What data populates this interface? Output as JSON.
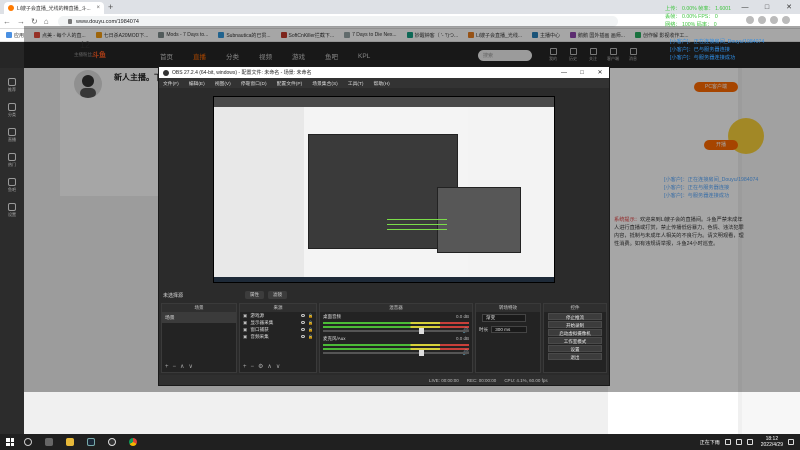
{
  "browser": {
    "tab_title": "Li嫂子会直播_光线的精直播_斗...",
    "url": "www.douyu.com/1984074",
    "bookmarks": [
      "应用",
      "点美 - 每个人的直...",
      "七日杀A20MOD下...",
      "Mods - 7 Days to...",
      "Subnautica的已贯...",
      "SoftCnKiller拦截下...",
      "7 Days to Die Nex...",
      "妙醒钟客（ '- '!)つ...",
      "Li嫂子会直播_光线...",
      "主播中心",
      "鹅鹅 国外插画 画师...",
      "创作解 影视收作工..."
    ]
  },
  "douyu": {
    "logo": "斗鱼",
    "nav": [
      "首页",
      "直播",
      "分类",
      "视频",
      "游戏",
      "鱼吧",
      "KPL"
    ],
    "nav_active_index": 1,
    "search_placeholder": "搜索",
    "right_nav": [
      "我的",
      "历史",
      "关注",
      "客户端",
      "消息"
    ],
    "follow_count": "12",
    "follow_label": "主播粉丝",
    "anchor_name": "新人主播。下",
    "left_sidebar": [
      "推荐",
      "分类",
      "直播",
      "热门",
      "鱼吧",
      "设置"
    ],
    "pc_button": "PC客户端",
    "right_button": "开播",
    "chat_lines": [
      "[小客户]：正在连接房间_Douyu/1984074",
      "[小客户]：正在与服务器连接",
      "[小客户]：与服务器连接成功"
    ],
    "system_prefix": "系统提示：",
    "system_message": "欢迎来到Li嫂子会的直播间。斗鱼严禁未成年人进行直播或打赏，禁止传播低俗暴力、色情、违法犯罪内容，抵制与未成年人相关的不良行为。请文明观看，理性消费。如有违规请举报，斗鱼24小时巡查。"
  },
  "stream_overlay": {
    "rows": [
      "上传：   0.00%   帧率：   1.6001",
      "丢帧：   0.00%   FPS：    0",
      "网络：   100%    码率：   0"
    ],
    "links": [
      "[小客户]：正在连接房间_Douyu/1984074",
      "[小客户]：已与服务器连接",
      "[小客户]：与服务器连接成功"
    ]
  },
  "obs": {
    "title": "OBS 27.2.4 (64-bit, windows) - 配置文件: 未命名 - 场景: 未命名",
    "menu": [
      "文件(F)",
      "编辑(E)",
      "视图(V)",
      "停靠窗口(D)",
      "配置文件(P)",
      "场景集合(S)",
      "工具(T)",
      "帮助(H)"
    ],
    "scene_label": "未选择源",
    "preview_buttons": [
      "属性",
      "滤镜"
    ],
    "docks": {
      "scenes": "场景",
      "sources": "来源",
      "mixer": "混音器",
      "transitions": "转场特效",
      "controls": "控件"
    },
    "scene_items": [
      "场景"
    ],
    "source_items": [
      "游戏源",
      "显示器采集",
      "窗口捕获",
      "音频采集"
    ],
    "mixer_tracks": [
      {
        "name": "桌面音频",
        "db": "0.0 dB"
      },
      {
        "name": "麦克风/Aux",
        "db": "0.0 dB"
      }
    ],
    "transition_type": "渐变",
    "transition_duration_label": "时长",
    "transition_duration": "300 ms",
    "controls": [
      "停止推流",
      "开始录制",
      "启动虚拟摄像机",
      "工作室模式",
      "设置",
      "退出"
    ],
    "status": [
      "LIVE: 00:00:00",
      "REC: 00:00:00",
      "CPU: 4.1%, 60.00 fps"
    ]
  },
  "taskbar": {
    "weather": "正在下雨",
    "time": "18:12",
    "date": "2022/4/29"
  }
}
